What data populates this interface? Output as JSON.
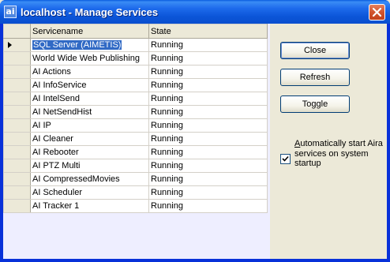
{
  "window": {
    "icon_text": "ai",
    "title": "localhost - Manage Services"
  },
  "grid": {
    "columns": [
      "Servicename",
      "State"
    ],
    "rows": [
      {
        "name": "SQL Server (AIMETIS)",
        "state": "Running",
        "selected": true
      },
      {
        "name": "World Wide Web Publishing",
        "state": "Running"
      },
      {
        "name": "AI Actions",
        "state": "Running"
      },
      {
        "name": "AI InfoService",
        "state": "Running"
      },
      {
        "name": "AI IntelSend",
        "state": "Running"
      },
      {
        "name": "AI NetSendHist",
        "state": "Running"
      },
      {
        "name": "AI IP",
        "state": "Running"
      },
      {
        "name": "AI Cleaner",
        "state": "Running"
      },
      {
        "name": "AI Rebooter",
        "state": "Running"
      },
      {
        "name": "AI PTZ Multi",
        "state": "Running"
      },
      {
        "name": "AI CompressedMovies",
        "state": "Running"
      },
      {
        "name": "AI Scheduler",
        "state": "Running"
      },
      {
        "name": "AI Tracker 1",
        "state": "Running"
      }
    ]
  },
  "buttons": {
    "close": "Close",
    "refresh": "Refresh",
    "toggle": "Toggle"
  },
  "options": {
    "auto_start_label_accel": "A",
    "auto_start_label_rest": "utomatically start Aira services on system startup",
    "auto_start_checked": true
  },
  "icons": {
    "title_close": "close-icon",
    "row_indicator": "row-pointer-icon",
    "check": "checkmark-icon"
  },
  "colors": {
    "titlebar": "#0a55d8",
    "selection": "#316ac5",
    "face": "#ece9d8",
    "grid_background": "#eeeeff"
  }
}
